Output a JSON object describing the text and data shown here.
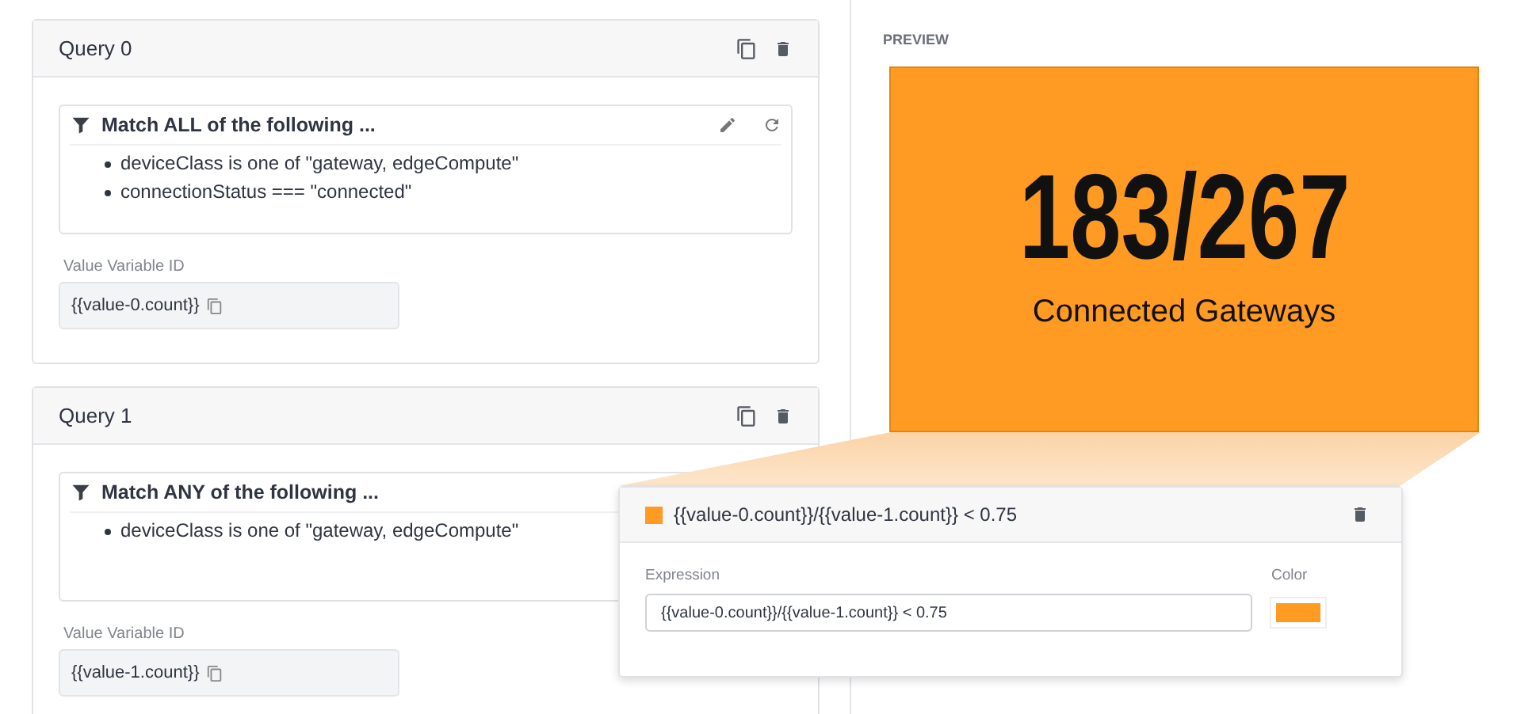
{
  "queries": [
    {
      "title": "Query 0",
      "filter": {
        "heading": "Match ALL of the following ...",
        "tools": [
          {
            "kind": "edit"
          },
          {
            "kind": "refresh"
          }
        ],
        "conditions": [
          "deviceClass is one of \"gateway, edgeCompute\"",
          "connectionStatus === \"connected\""
        ]
      },
      "variable_label": "Value Variable ID",
      "variable_value": "{{value-0.count}}"
    },
    {
      "title": "Query 1",
      "filter": {
        "heading": "Match ANY of the following ...",
        "conditions": [
          "deviceClass is one of \"gateway, edgeCompute\""
        ]
      },
      "variable_label": "Value Variable ID",
      "variable_value": "{{value-1.count}}"
    }
  ],
  "preview": {
    "label": "PREVIEW",
    "value": "183/267",
    "caption": "Connected Gateways",
    "color": "#ff9a22"
  },
  "condition_popup": {
    "title": "{{value-0.count}}/{{value-1.count}} < 0.75",
    "color": "#ff9a22",
    "expression_label": "Expression",
    "expression": "{{value-0.count}}/{{value-1.count}} < 0.75",
    "color_label": "Color"
  }
}
